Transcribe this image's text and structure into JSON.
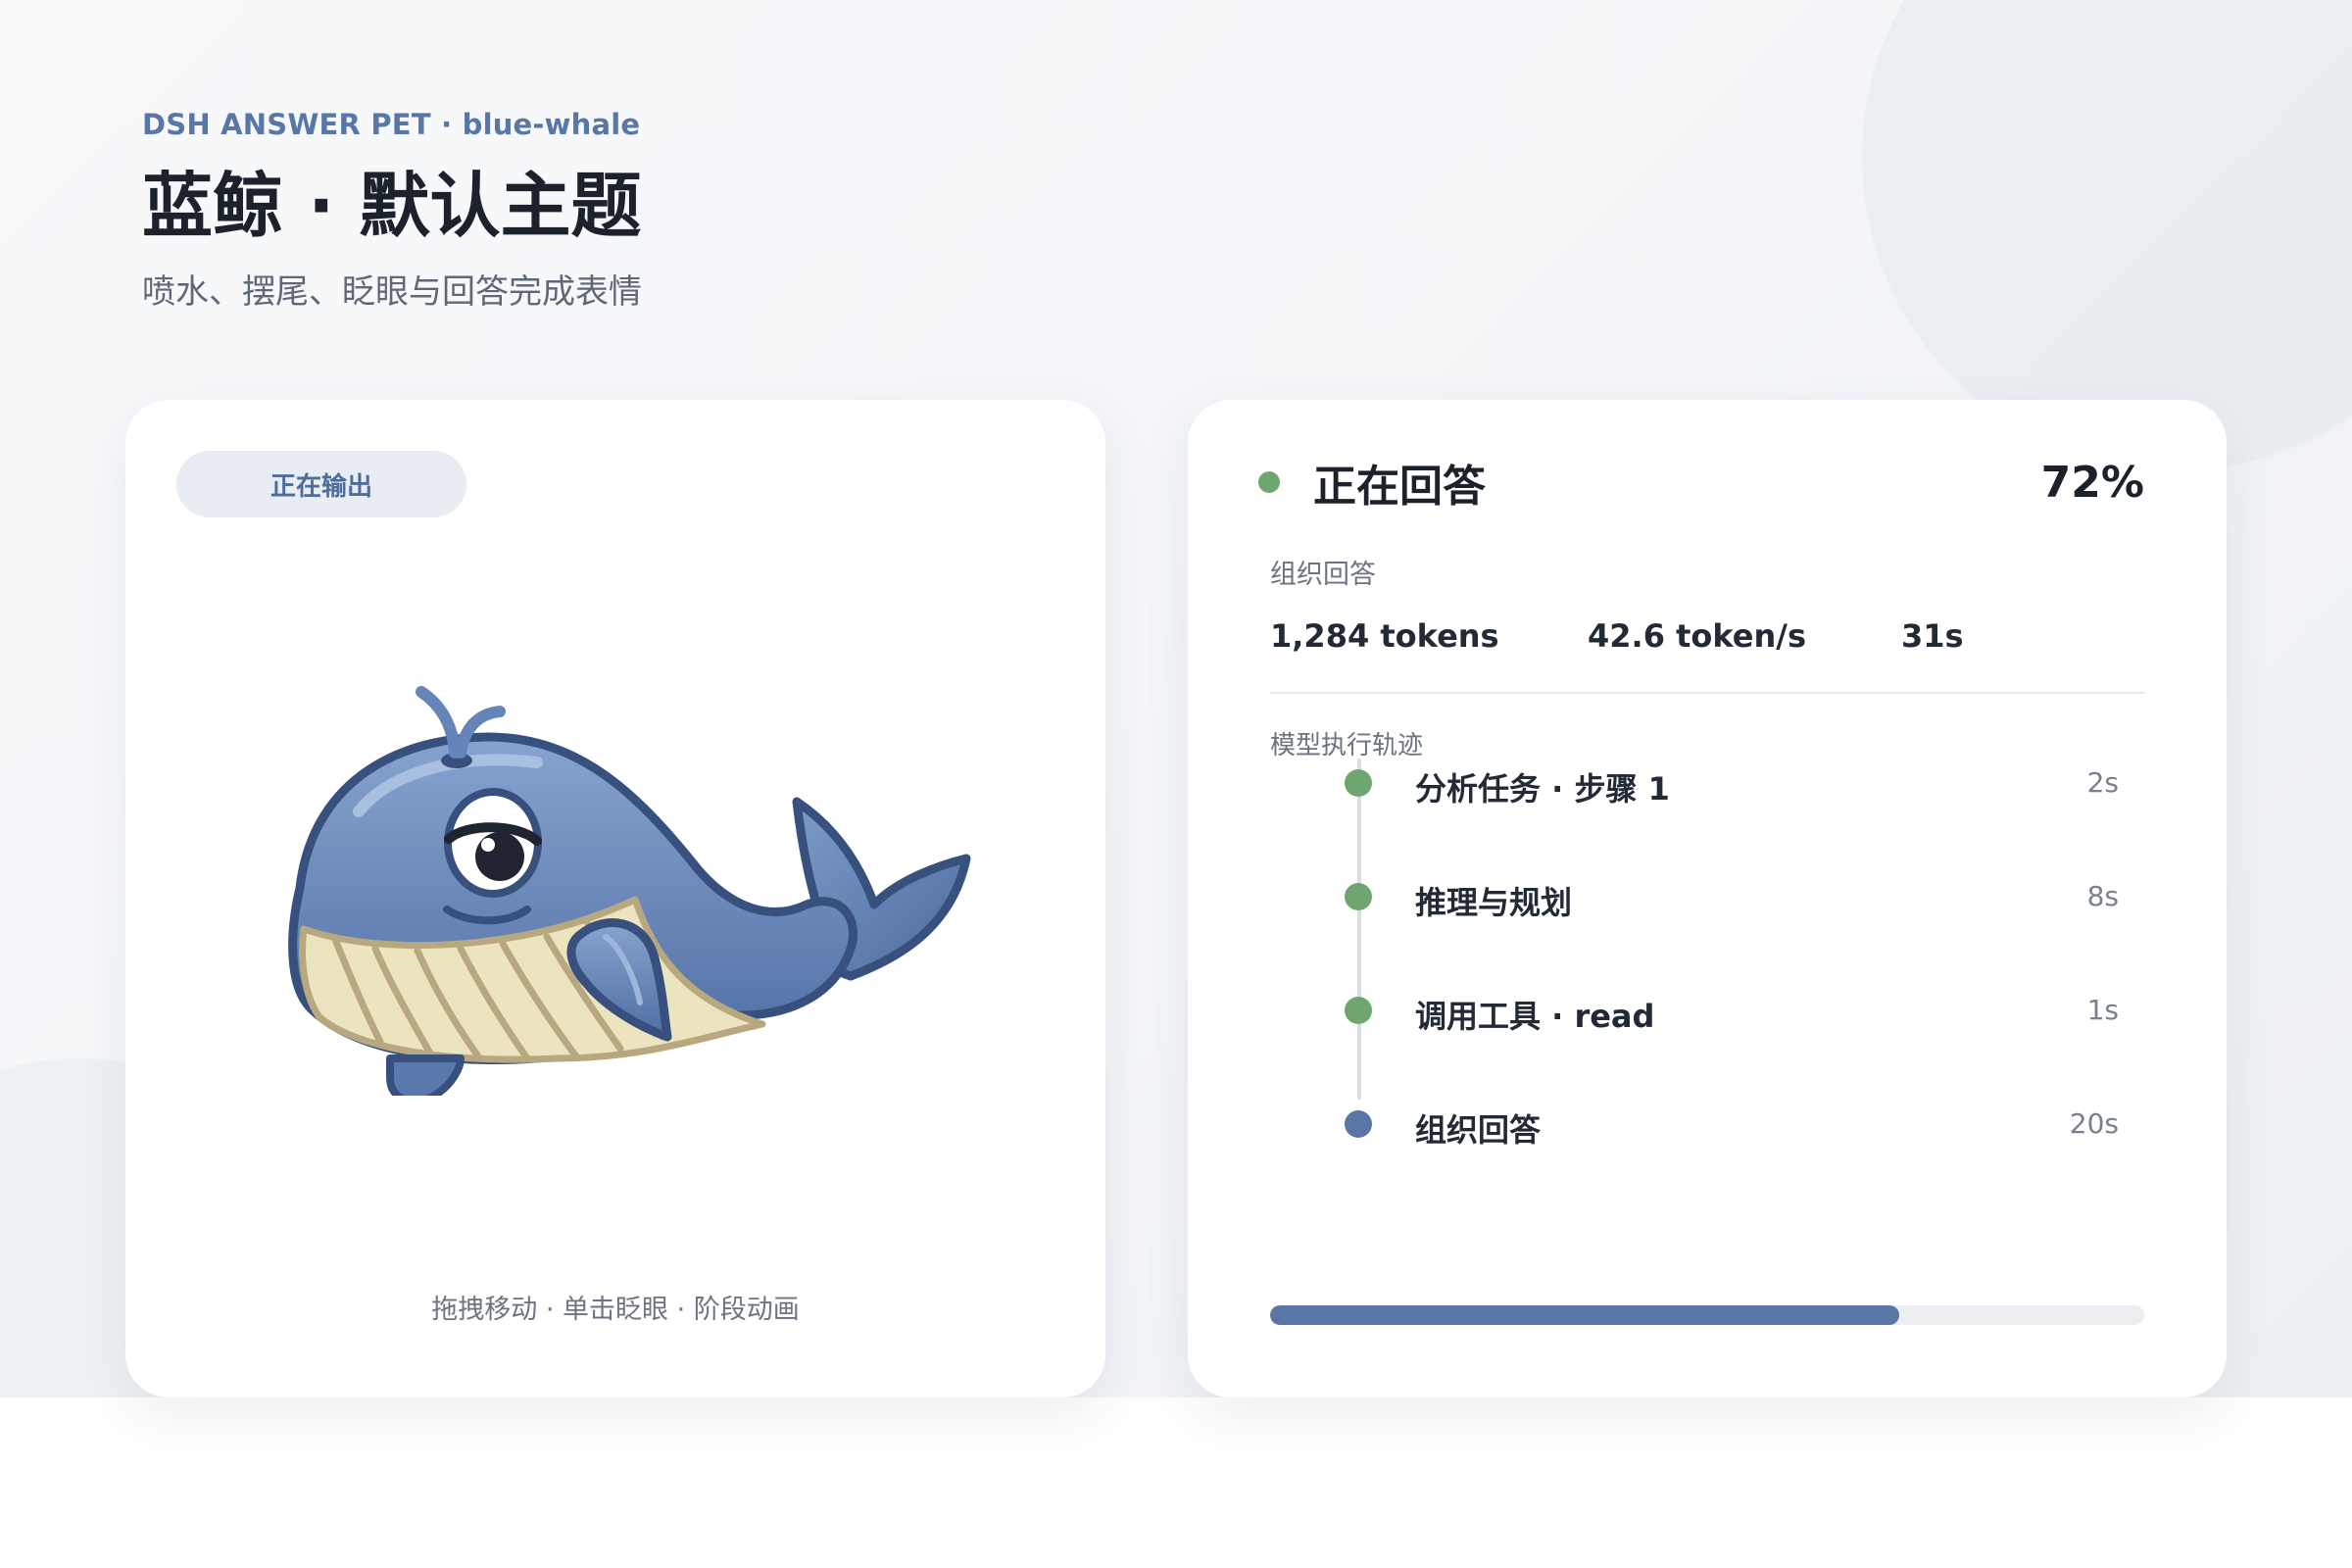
{
  "header": {
    "kicker": "DSH ANSWER PET · blue-whale",
    "title": "蓝鲸 · 默认主题",
    "subtitle": "喷水、摆尾、眨眼与回答完成表情"
  },
  "pet": {
    "chip_label": "正在输出",
    "character_icon": "blue-whale",
    "hint": "拖拽移动 · 单击眨眼 · 阶段动画"
  },
  "status": {
    "title": "正在回答",
    "percent_text": "72%",
    "progress": 0.72,
    "stage": "组织回答",
    "metrics": {
      "tokens": "1,284 tokens",
      "speed": "42.6 token/s",
      "elapsed": "31s"
    },
    "trace_label": "模型执行轨迹",
    "steps": [
      {
        "label": "分析任务 · 步骤 1",
        "time": "2s",
        "state": "done"
      },
      {
        "label": "推理与规划",
        "time": "8s",
        "state": "done"
      },
      {
        "label": "调用工具 · read",
        "time": "1s",
        "state": "done"
      },
      {
        "label": "组织回答",
        "time": "20s",
        "state": "active"
      }
    ]
  },
  "colors": {
    "accent": "#5877a6",
    "done": "#6fa66f",
    "whale_body": "#6584b7",
    "whale_outline": "#38507d",
    "whale_belly": "#ece4bf"
  }
}
